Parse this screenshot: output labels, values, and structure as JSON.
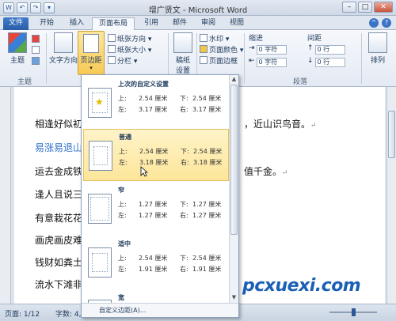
{
  "window": {
    "title": "增广贤文 - Microsoft Word",
    "minimize": "–",
    "maximize": "□",
    "close": "✕"
  },
  "qat": {
    "save": "W",
    "undo": "↶",
    "redo": "↷",
    "more": "▾"
  },
  "tabs": [
    "文件",
    "开始",
    "插入",
    "页面布局",
    "引用",
    "邮件",
    "审阅",
    "视图"
  ],
  "active_tab": "页面布局",
  "ribbon": {
    "themes_label": "主题",
    "theme_group_label": "主题",
    "text_direction_label": "文字方向",
    "margins_label": "页边距",
    "orientation_label": "纸张方向",
    "size_label": "纸张大小",
    "columns_label": "分栏",
    "manuscript_label": "稿纸\n设置",
    "watermark_label": "水印",
    "page_color_label": "页面颜色",
    "page_border_label": "页面边框",
    "indent_label": "缩进",
    "spacing_label": "间距",
    "indent_left_value": "0 字符",
    "indent_right_value": "0 字符",
    "spacing_before_value": "0 行",
    "spacing_after_value": "0 行",
    "paragraph_group_label": "段落",
    "arrange_label": "排列"
  },
  "document": {
    "lines": [
      {
        "left": "相逢好似初",
        "right": "，近山识鸟音。"
      },
      {
        "left": "易涨易退山",
        "right": ""
      },
      {
        "left": "运去金成铁",
        "right": "值千金。"
      },
      {
        "left": "逢人且说三",
        "right": ""
      },
      {
        "left": "有意栽花花",
        "right": ""
      },
      {
        "left": "画虎画皮难",
        "right": ""
      },
      {
        "left": "钱财如粪土",
        "right": ""
      },
      {
        "left": "流水下滩非",
        "right": ""
      }
    ],
    "para_mark": "↵"
  },
  "margins_menu": {
    "options": [
      {
        "title": "上次的自定义设置",
        "top_label": "上:",
        "top": "2.54 厘米",
        "bottom_label": "下:",
        "bottom": "2.54 厘米",
        "left_label": "左:",
        "left": "3.17 厘米",
        "right_label": "右:",
        "right": "3.17 厘米"
      },
      {
        "title": "普通",
        "top_label": "上:",
        "top": "2.54 厘米",
        "bottom_label": "下:",
        "bottom": "2.54 厘米",
        "left_label": "左:",
        "left": "3.18 厘米",
        "right_label": "右:",
        "right": "3.18 厘米"
      },
      {
        "title": "窄",
        "top_label": "上:",
        "top": "1.27 厘米",
        "bottom_label": "下:",
        "bottom": "1.27 厘米",
        "left_label": "左:",
        "left": "1.27 厘米",
        "right_label": "右:",
        "right": "1.27 厘米"
      },
      {
        "title": "适中",
        "top_label": "上:",
        "top": "2.54 厘米",
        "bottom_label": "下:",
        "bottom": "2.54 厘米",
        "left_label": "左:",
        "left": "1.91 厘米",
        "right_label": "右:",
        "right": "1.91 厘米"
      },
      {
        "title": "宽",
        "top_label": "",
        "top": "",
        "bottom_label": "",
        "bottom": "",
        "left_label": "",
        "left": "",
        "right_label": "",
        "right": ""
      }
    ],
    "footer": "自定义边距(A)..."
  },
  "statusbar": {
    "page": "页面: 1/12",
    "words": "字数: 4,52"
  },
  "watermark": "pcxuexi.com",
  "colors": {
    "file_tab": "#2a5ea8",
    "hover": "#fde69a",
    "accent": "#1a5fb4"
  }
}
